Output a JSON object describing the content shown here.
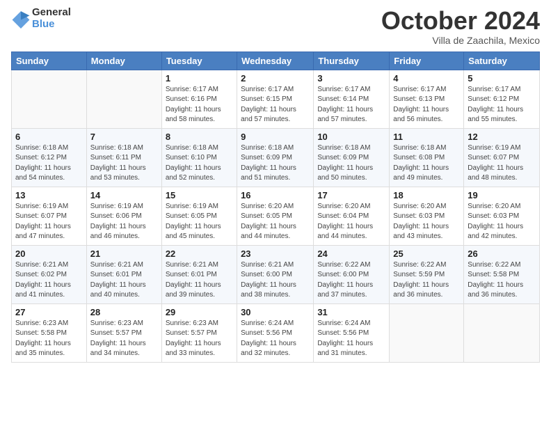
{
  "logo": {
    "general": "General",
    "blue": "Blue"
  },
  "header": {
    "month": "October 2024",
    "location": "Villa de Zaachila, Mexico"
  },
  "weekdays": [
    "Sunday",
    "Monday",
    "Tuesday",
    "Wednesday",
    "Thursday",
    "Friday",
    "Saturday"
  ],
  "weeks": [
    [
      {
        "day": "",
        "info": ""
      },
      {
        "day": "",
        "info": ""
      },
      {
        "day": "1",
        "info": "Sunrise: 6:17 AM\nSunset: 6:16 PM\nDaylight: 11 hours and 58 minutes."
      },
      {
        "day": "2",
        "info": "Sunrise: 6:17 AM\nSunset: 6:15 PM\nDaylight: 11 hours and 57 minutes."
      },
      {
        "day": "3",
        "info": "Sunrise: 6:17 AM\nSunset: 6:14 PM\nDaylight: 11 hours and 57 minutes."
      },
      {
        "day": "4",
        "info": "Sunrise: 6:17 AM\nSunset: 6:13 PM\nDaylight: 11 hours and 56 minutes."
      },
      {
        "day": "5",
        "info": "Sunrise: 6:17 AM\nSunset: 6:12 PM\nDaylight: 11 hours and 55 minutes."
      }
    ],
    [
      {
        "day": "6",
        "info": "Sunrise: 6:18 AM\nSunset: 6:12 PM\nDaylight: 11 hours and 54 minutes."
      },
      {
        "day": "7",
        "info": "Sunrise: 6:18 AM\nSunset: 6:11 PM\nDaylight: 11 hours and 53 minutes."
      },
      {
        "day": "8",
        "info": "Sunrise: 6:18 AM\nSunset: 6:10 PM\nDaylight: 11 hours and 52 minutes."
      },
      {
        "day": "9",
        "info": "Sunrise: 6:18 AM\nSunset: 6:09 PM\nDaylight: 11 hours and 51 minutes."
      },
      {
        "day": "10",
        "info": "Sunrise: 6:18 AM\nSunset: 6:09 PM\nDaylight: 11 hours and 50 minutes."
      },
      {
        "day": "11",
        "info": "Sunrise: 6:18 AM\nSunset: 6:08 PM\nDaylight: 11 hours and 49 minutes."
      },
      {
        "day": "12",
        "info": "Sunrise: 6:19 AM\nSunset: 6:07 PM\nDaylight: 11 hours and 48 minutes."
      }
    ],
    [
      {
        "day": "13",
        "info": "Sunrise: 6:19 AM\nSunset: 6:07 PM\nDaylight: 11 hours and 47 minutes."
      },
      {
        "day": "14",
        "info": "Sunrise: 6:19 AM\nSunset: 6:06 PM\nDaylight: 11 hours and 46 minutes."
      },
      {
        "day": "15",
        "info": "Sunrise: 6:19 AM\nSunset: 6:05 PM\nDaylight: 11 hours and 45 minutes."
      },
      {
        "day": "16",
        "info": "Sunrise: 6:20 AM\nSunset: 6:05 PM\nDaylight: 11 hours and 44 minutes."
      },
      {
        "day": "17",
        "info": "Sunrise: 6:20 AM\nSunset: 6:04 PM\nDaylight: 11 hours and 44 minutes."
      },
      {
        "day": "18",
        "info": "Sunrise: 6:20 AM\nSunset: 6:03 PM\nDaylight: 11 hours and 43 minutes."
      },
      {
        "day": "19",
        "info": "Sunrise: 6:20 AM\nSunset: 6:03 PM\nDaylight: 11 hours and 42 minutes."
      }
    ],
    [
      {
        "day": "20",
        "info": "Sunrise: 6:21 AM\nSunset: 6:02 PM\nDaylight: 11 hours and 41 minutes."
      },
      {
        "day": "21",
        "info": "Sunrise: 6:21 AM\nSunset: 6:01 PM\nDaylight: 11 hours and 40 minutes."
      },
      {
        "day": "22",
        "info": "Sunrise: 6:21 AM\nSunset: 6:01 PM\nDaylight: 11 hours and 39 minutes."
      },
      {
        "day": "23",
        "info": "Sunrise: 6:21 AM\nSunset: 6:00 PM\nDaylight: 11 hours and 38 minutes."
      },
      {
        "day": "24",
        "info": "Sunrise: 6:22 AM\nSunset: 6:00 PM\nDaylight: 11 hours and 37 minutes."
      },
      {
        "day": "25",
        "info": "Sunrise: 6:22 AM\nSunset: 5:59 PM\nDaylight: 11 hours and 36 minutes."
      },
      {
        "day": "26",
        "info": "Sunrise: 6:22 AM\nSunset: 5:58 PM\nDaylight: 11 hours and 36 minutes."
      }
    ],
    [
      {
        "day": "27",
        "info": "Sunrise: 6:23 AM\nSunset: 5:58 PM\nDaylight: 11 hours and 35 minutes."
      },
      {
        "day": "28",
        "info": "Sunrise: 6:23 AM\nSunset: 5:57 PM\nDaylight: 11 hours and 34 minutes."
      },
      {
        "day": "29",
        "info": "Sunrise: 6:23 AM\nSunset: 5:57 PM\nDaylight: 11 hours and 33 minutes."
      },
      {
        "day": "30",
        "info": "Sunrise: 6:24 AM\nSunset: 5:56 PM\nDaylight: 11 hours and 32 minutes."
      },
      {
        "day": "31",
        "info": "Sunrise: 6:24 AM\nSunset: 5:56 PM\nDaylight: 11 hours and 31 minutes."
      },
      {
        "day": "",
        "info": ""
      },
      {
        "day": "",
        "info": ""
      }
    ]
  ]
}
